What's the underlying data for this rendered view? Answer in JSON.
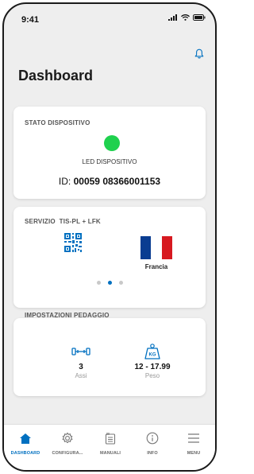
{
  "status_bar": {
    "time": "9:41"
  },
  "page": {
    "title": "Dashboard"
  },
  "device_status": {
    "title": "STATO DISPOSITIVO",
    "led_color": "#1fd14e",
    "led_label": "LED DISPOSITIVO",
    "id_prefix": "ID:",
    "id_value": "00059 08366001153"
  },
  "service": {
    "title": "SERVIZIO  TIS-PL + LFK",
    "country": "Francia",
    "flag_colors": [
      "#0a3d91",
      "#ffffff",
      "#d71920"
    ],
    "carousel_total": 3,
    "carousel_active": 2
  },
  "toll_settings": {
    "title": "IMPOSTAZIONI PEDAGGIO",
    "axles_value": "3",
    "axles_label": "Assi",
    "weight_icon_text": "KG",
    "weight_value": "12 - 17.99",
    "weight_label": "Peso"
  },
  "bottom_nav": {
    "items": [
      {
        "label": "DASHBOARD",
        "icon": "home-icon"
      },
      {
        "label": "CONFIGURA...",
        "icon": "gear-icon"
      },
      {
        "label": "MANUALI",
        "icon": "manual-icon"
      },
      {
        "label": "INFO",
        "icon": "info-icon"
      },
      {
        "label": "MENU",
        "icon": "hamburger-icon"
      }
    ]
  },
  "colors": {
    "accent": "#0070c0",
    "led_on": "#1fd14e"
  }
}
